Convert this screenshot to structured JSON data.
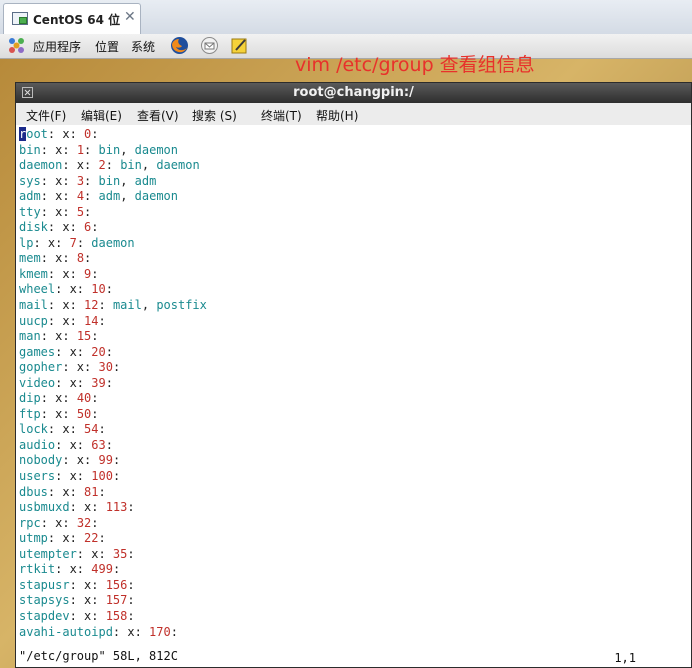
{
  "vm_tab": {
    "label": "CentOS 64 位",
    "close": "✕"
  },
  "panel": {
    "menus": {
      "applications": "应用程序",
      "places": "位置",
      "system": "系统"
    },
    "icons": [
      "applications-icon",
      "firefox-icon",
      "mail-icon",
      "notes-icon"
    ]
  },
  "terminal": {
    "title": "root@changpin:/",
    "menus": {
      "file": "文件(F)",
      "edit": "编辑(E)",
      "view": "查看(V)",
      "search": "搜索 (S)",
      "terminal": "终端(T)",
      "help": "帮助(H)"
    },
    "colors": {
      "group_name": "#1a8a8f",
      "number": "#c0302a",
      "cursor": "#1b2a8a"
    },
    "lines": [
      {
        "name": "root",
        "gid": "0",
        "members": ""
      },
      {
        "name": "bin",
        "gid": "1",
        "members": "bin, daemon"
      },
      {
        "name": "daemon",
        "gid": "2",
        "members": "bin, daemon"
      },
      {
        "name": "sys",
        "gid": "3",
        "members": "bin, adm"
      },
      {
        "name": "adm",
        "gid": "4",
        "members": "adm, daemon"
      },
      {
        "name": "tty",
        "gid": "5",
        "members": ""
      },
      {
        "name": "disk",
        "gid": "6",
        "members": ""
      },
      {
        "name": "lp",
        "gid": "7",
        "members": "daemon"
      },
      {
        "name": "mem",
        "gid": "8",
        "members": ""
      },
      {
        "name": "kmem",
        "gid": "9",
        "members": ""
      },
      {
        "name": "wheel",
        "gid": "10",
        "members": ""
      },
      {
        "name": "mail",
        "gid": "12",
        "members": "mail, postfix"
      },
      {
        "name": "uucp",
        "gid": "14",
        "members": ""
      },
      {
        "name": "man",
        "gid": "15",
        "members": ""
      },
      {
        "name": "games",
        "gid": "20",
        "members": ""
      },
      {
        "name": "gopher",
        "gid": "30",
        "members": ""
      },
      {
        "name": "video",
        "gid": "39",
        "members": ""
      },
      {
        "name": "dip",
        "gid": "40",
        "members": ""
      },
      {
        "name": "ftp",
        "gid": "50",
        "members": ""
      },
      {
        "name": "lock",
        "gid": "54",
        "members": ""
      },
      {
        "name": "audio",
        "gid": "63",
        "members": ""
      },
      {
        "name": "nobody",
        "gid": "99",
        "members": ""
      },
      {
        "name": "users",
        "gid": "100",
        "members": ""
      },
      {
        "name": "dbus",
        "gid": "81",
        "members": ""
      },
      {
        "name": "usbmuxd",
        "gid": "113",
        "members": ""
      },
      {
        "name": "rpc",
        "gid": "32",
        "members": ""
      },
      {
        "name": "utmp",
        "gid": "22",
        "members": ""
      },
      {
        "name": "utempter",
        "gid": "35",
        "members": ""
      },
      {
        "name": "rtkit",
        "gid": "499",
        "members": ""
      },
      {
        "name": "stapusr",
        "gid": "156",
        "members": ""
      },
      {
        "name": "stapsys",
        "gid": "157",
        "members": ""
      },
      {
        "name": "stapdev",
        "gid": "158",
        "members": ""
      },
      {
        "name": "avahi-autoipd",
        "gid": "170",
        "members": ""
      }
    ],
    "status_left": "\"/etc/group\" 58L, 812C",
    "status_right": "1,1"
  },
  "annotation": "vim /etc/group 查看组信息"
}
